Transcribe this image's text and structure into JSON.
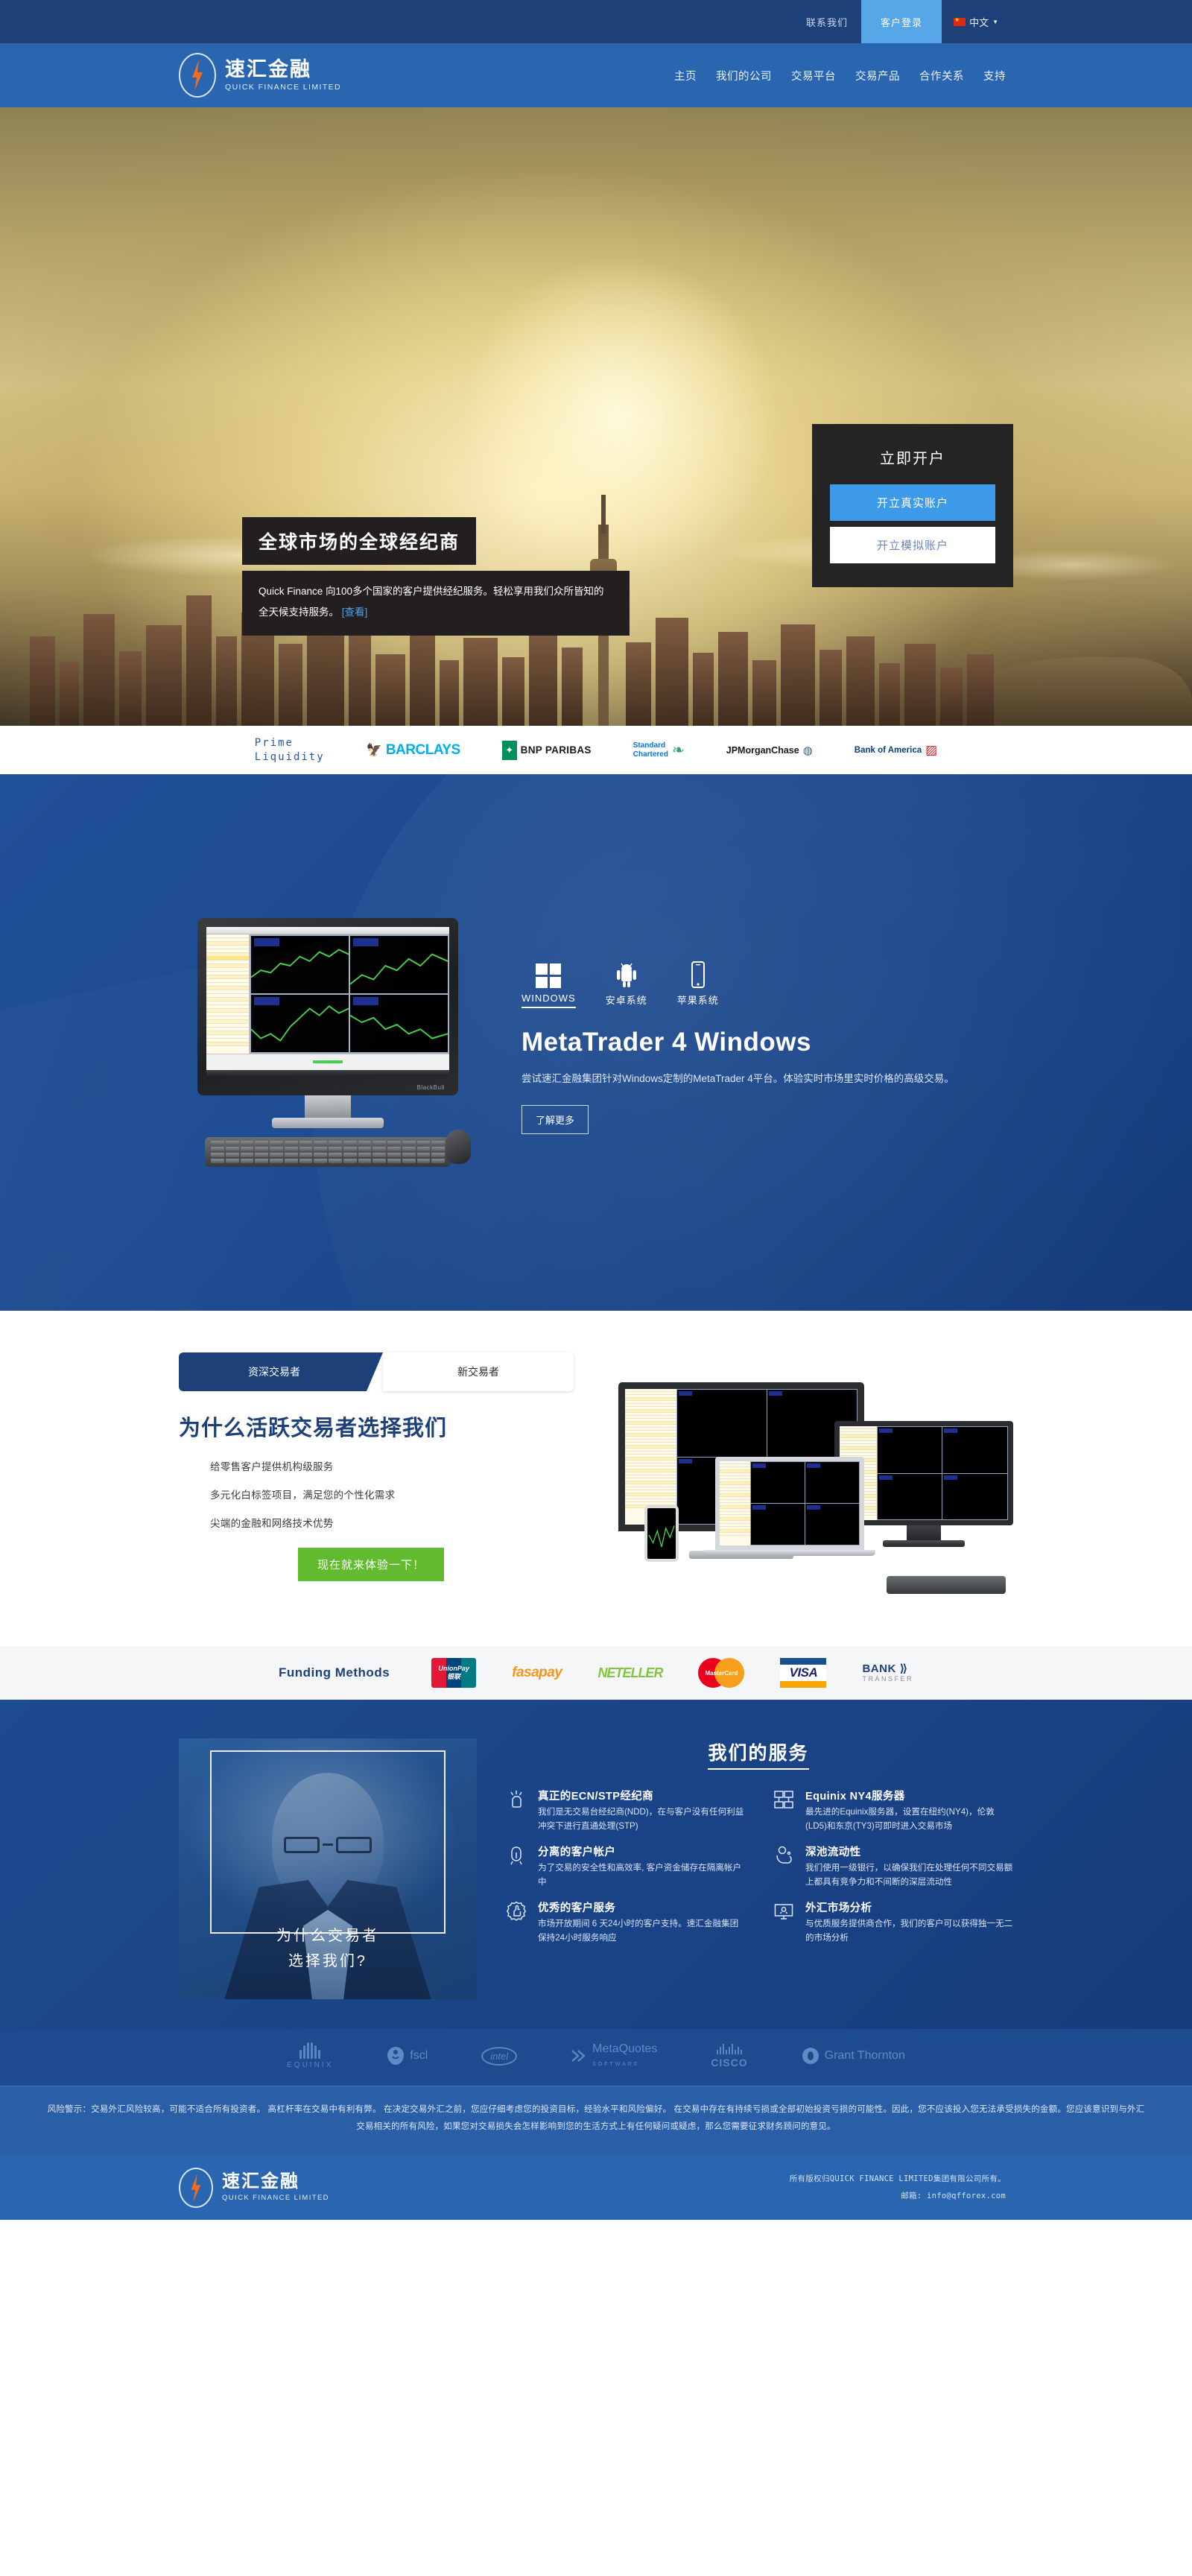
{
  "topbar": {
    "contact_label": "联系我们",
    "client_login_label": "客户登录",
    "language_label": "中文",
    "highlight_color": "#57a7e8",
    "bar_color": "#1e4079"
  },
  "brand": {
    "name_cn": "速汇金融",
    "name_en": "QUICK FINANCE LIMITED",
    "accent_color": "#f36a21"
  },
  "nav": {
    "items": [
      {
        "label": "主页"
      },
      {
        "label": "我们的公司"
      },
      {
        "label": "交易平台"
      },
      {
        "label": "交易产品"
      },
      {
        "label": "合作关系"
      },
      {
        "label": "支持"
      }
    ]
  },
  "hero": {
    "title": "全球市场的全球经纪商",
    "subtitle": "Quick Finance 向100多个国家的客户提供经纪服务。轻松享用我们众所皆知的全天候支持服务。",
    "subtitle_link": "[查看]",
    "signup": {
      "title": "立即开户",
      "live_button": "开立真实账户",
      "demo_button": "开立模拟账户",
      "live_color": "#3d9ae8"
    }
  },
  "liquidity": {
    "label_line1": "Prime",
    "label_line2": "Liquidity",
    "banks": [
      {
        "name": "BARCLAYS",
        "icon": "barclays-eagle-icon"
      },
      {
        "name": "BNP PARIBAS",
        "icon": "bnp-paribas-icon"
      },
      {
        "name_line1": "Standard",
        "name_line2": "Chartered",
        "icon": "standard-chartered-icon"
      },
      {
        "name": "JPMorganChase",
        "icon": "jpmorgan-icon"
      },
      {
        "name": "Bank of America",
        "icon": "bank-of-america-icon"
      }
    ]
  },
  "platform": {
    "os_tabs": [
      {
        "label": "WINDOWS",
        "icon": "windows-icon",
        "active": true
      },
      {
        "label": "安卓系统",
        "icon": "android-icon",
        "active": false
      },
      {
        "label": "苹果系统",
        "icon": "apple-phone-icon",
        "active": false
      }
    ],
    "heading": "MetaTrader 4 Windows",
    "paragraph": "尝试速汇金融集团针对Windows定制的MetaTrader 4平台。体验实时市场里实时价格的高级交易。",
    "cta": "了解更多"
  },
  "why": {
    "tabs": [
      {
        "label": "资深交易者",
        "active": true
      },
      {
        "label": "新交易者",
        "active": false
      }
    ],
    "heading": "为什么活跃交易者选择我们",
    "bullets": [
      "给零售客户提供机构级服务",
      "多元化白标签项目，满足您的个性化需求",
      "尖端的金融和网络技术优势"
    ],
    "cta": "现在就来体验一下！",
    "cta_color": "#62bb2f"
  },
  "funding": {
    "label": "Funding Methods",
    "methods": [
      {
        "name": "UnionPay",
        "sub": "银联"
      },
      {
        "name": "fasapay"
      },
      {
        "name": "NETELLER"
      },
      {
        "name": "MasterCard"
      },
      {
        "name": "VISA"
      },
      {
        "name": "BANK",
        "sub": "TRANSFER"
      }
    ]
  },
  "services": {
    "photo_caption_line1": "为什么交易者",
    "photo_caption_line2": "选择我们?",
    "title": "我们的服务",
    "items": [
      {
        "icon": "handshake-icon",
        "title": "真正的ECN/STP经纪商",
        "text": "我们是无交易台经纪商(NDD)，在与客户没有任何利益冲突下进行直通处理(STP)"
      },
      {
        "icon": "servers-icon",
        "title": "Equinix NY4服务器",
        "text": "最先进的Equinix服务器，设置在纽约(NY4)，伦敦(LD5)和东京(TY3)可即时进入交易市场"
      },
      {
        "icon": "vault-icon",
        "title": "分离的客户帐户",
        "text": "为了交易的安全性和高效率, 客户资金储存在隔离帐户中"
      },
      {
        "icon": "piggy-bank-icon",
        "title": "深池流动性",
        "text": "我们使用一级银行，以确保我们在处理任何不同交易额上都具有竞争力和不间断的深层流动性"
      },
      {
        "icon": "thumbs-up-badge-icon",
        "title": "优秀的客户服务",
        "text": "市场开放期间 6 天24小时的客户支持。速汇金融集团保持24小时服务响应"
      },
      {
        "icon": "analysis-monitor-icon",
        "title": "外汇市场分析",
        "text": "与优质服务提供商合作，我们的客户可以获得独一无二的市场分析"
      }
    ]
  },
  "partners": [
    {
      "name": "EQUINIX",
      "icon": "equinix-icon"
    },
    {
      "name": "fscl",
      "icon": "fscl-icon"
    },
    {
      "name": "intel",
      "icon": "intel-icon"
    },
    {
      "name": "MetaQuotes",
      "sub": "SOFTWARE",
      "icon": "metaquotes-icon"
    },
    {
      "name": "CISCO",
      "icon": "cisco-icon"
    },
    {
      "name": "Grant Thornton",
      "icon": "grant-thornton-icon"
    }
  ],
  "risk": {
    "text": "风险警示：交易外汇风险较高，可能不适合所有投资者。 高杠杆率在交易中有利有弊。 在决定交易外汇之前，您应仔细考虑您的投资目标，经验水平和风险偏好。 在交易中存在有持续亏损或全部初始投资亏损的可能性。因此，您不应该投入您无法承受损失的金额。您应该意识到与外汇交易相关的所有风险，如果您对交易损失会怎样影响到您的生活方式上有任何疑问或疑虑，那么您需要征求财务顾问的意见。"
  },
  "footer": {
    "copyright": "所有版权归QUICK FINANCE LIMITED集团有限公司所有。",
    "email": "邮箱: info@qfforex.com"
  }
}
